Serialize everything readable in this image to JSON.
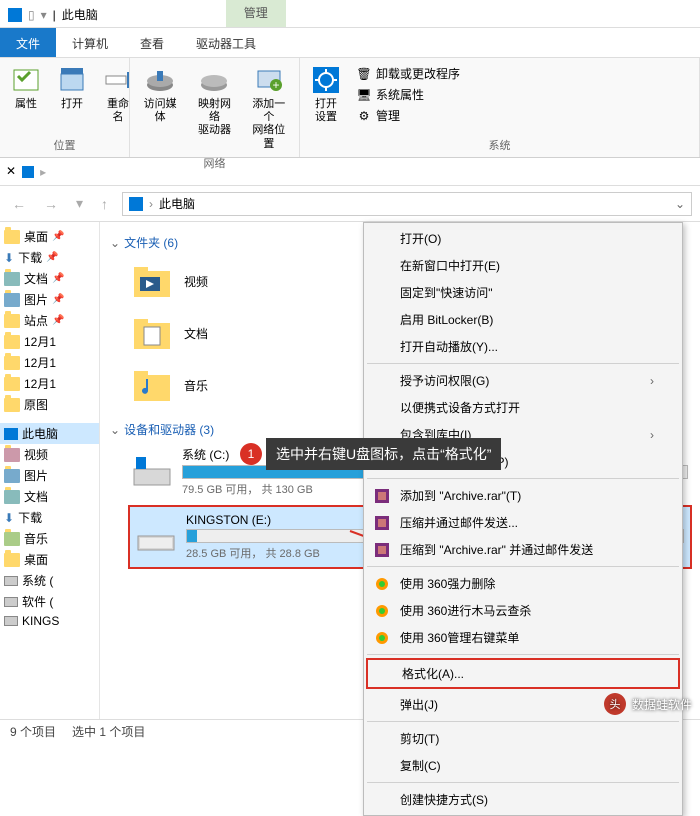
{
  "title": "此电脑",
  "manage_tab": "管理",
  "ribbon_tabs": {
    "file": "文件",
    "computer": "计算机",
    "view": "查看",
    "drive_tools": "驱动器工具"
  },
  "groups": {
    "location": "位置",
    "network": "网络",
    "system": "系统"
  },
  "rbtn": {
    "properties": "属性",
    "open": "打开",
    "rename": "重命名",
    "access_media": "访问媒体",
    "map_drive": "映射网络\n驱动器",
    "add_loc": "添加一个\n网络位置",
    "open_settings": "打开\n设置"
  },
  "sys": {
    "uninstall": "卸载或更改程序",
    "props": "系统属性",
    "manage": "管理"
  },
  "addr_path": "此电脑",
  "tree": {
    "desktop": "桌面",
    "download": "下载",
    "docs": "文档",
    "pics": "图片",
    "site": "站点",
    "d121": "12月1",
    "d122": "12月1",
    "d123": "12月1",
    "orig": "原图",
    "thispc": "此电脑",
    "video": "视频",
    "pic2": "图片",
    "doc2": "文档",
    "dl2": "下载",
    "music": "音乐",
    "desk2": "桌面",
    "sysc": "系统 (",
    "soft": "软件 (",
    "kings": "KINGS"
  },
  "sections": {
    "folders": "文件夹 (6)",
    "drives": "设备和驱动器 (3)"
  },
  "items": {
    "video": "视频",
    "docs": "文档",
    "music": "音乐"
  },
  "drive_c": {
    "name": "系统 (C:)",
    "sub": "79.5 GB 可用， 共 130 GB"
  },
  "drive_e": {
    "name": "KINGSTON (E:)",
    "sub": "28.5 GB 可用， 共 28.8 GB"
  },
  "annot": {
    "num": "1",
    "text": "选中并右键U盘图标，点击“格式化”"
  },
  "ctx": {
    "open": "打开(O)",
    "new_window": "在新窗口中打开(E)",
    "pin_quick": "固定到\"快速访问\"",
    "bitlocker": "启用 BitLocker(B)",
    "autoplay": "打开自动播放(Y)...",
    "grant": "授予访问权限(G)",
    "portable": "以便携式设备方式打开",
    "include": "包含到库中(I)",
    "pin_start": "固定到\"开始\"屏幕(P)",
    "add_rar": "添加到 \"Archive.rar\"(T)",
    "compress_email": "压缩并通过邮件发送...",
    "compress_rar_email": "压缩到 \"Archive.rar\" 并通过邮件发送",
    "del360": "使用 360强力删除",
    "scan360": "使用 360进行木马云查杀",
    "menu360": "使用 360管理右键菜单",
    "format": "格式化(A)...",
    "eject": "弹出(J)",
    "cut": "剪切(T)",
    "copy": "复制(C)",
    "shortcut": "创建快捷方式(S)"
  },
  "status": {
    "count": "9 个项目",
    "sel": "选中 1 个项目"
  },
  "watermark": "数据蛙软件"
}
